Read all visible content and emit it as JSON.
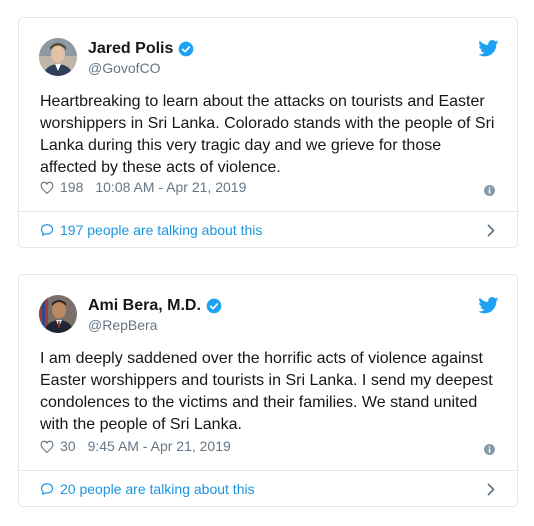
{
  "colors": {
    "link": "#1b95e0",
    "verified": "#1da1f2",
    "muted": "#657786",
    "border": "#e1e8ed"
  },
  "tweets": [
    {
      "name": "Jared Polis",
      "handle": "@GovofCO",
      "text": "Heartbreaking to learn about the attacks on tourists and Easter worshippers in Sri Lanka. Colorado stands with the people of Sri Lanka during this very tragic day and we grieve for those affected by these acts of violence.",
      "likes": "198",
      "timestamp": "10:08 AM - Apr 21, 2019",
      "talking": "197 people are talking about this",
      "icons": [
        "avatar",
        "verified-icon",
        "twitter-bird-icon",
        "heart-icon",
        "info-icon",
        "comment-bubble-icon",
        "chevron-right-icon"
      ]
    },
    {
      "name": "Ami Bera, M.D.",
      "handle": "@RepBera",
      "text": "I am deeply saddened over the horrific acts of violence against Easter worshippers and tourists in Sri Lanka. I send my deepest condolences to the victims and their families. We stand united with the people of Sri Lanka.",
      "likes": "30",
      "timestamp": "9:45 AM - Apr 21, 2019",
      "talking": "20 people are talking about this",
      "icons": [
        "avatar",
        "verified-icon",
        "twitter-bird-icon",
        "heart-icon",
        "info-icon",
        "comment-bubble-icon",
        "chevron-right-icon"
      ]
    }
  ]
}
